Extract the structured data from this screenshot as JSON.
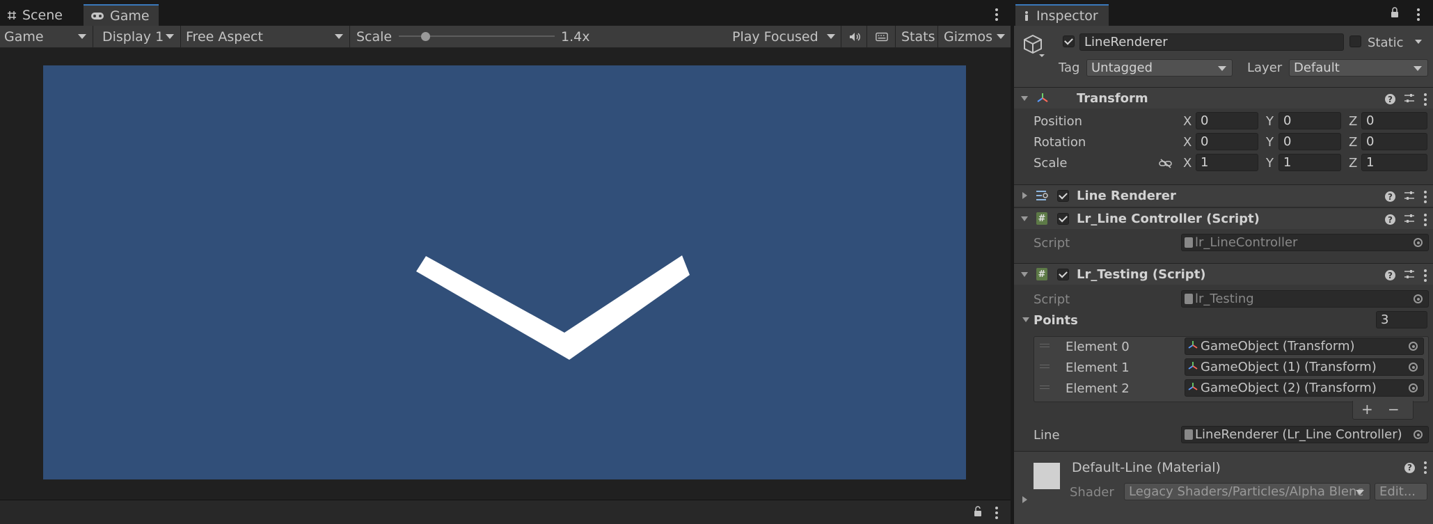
{
  "game_view": {
    "tabs": [
      {
        "label": "Scene",
        "icon": "hash-grid-icon"
      },
      {
        "label": "Game",
        "icon": "gamepad-icon"
      }
    ],
    "toolbar": {
      "mode": "Game",
      "display": "Display 1",
      "aspect": "Free Aspect",
      "scale_label": "Scale",
      "scale_value": "1.4x",
      "scale_slider_fraction": 0.17,
      "play_mode": "Play Focused",
      "stats": "Stats",
      "gizmos": "Gizmos"
    },
    "colors": {
      "canvas_bg": "#314f79",
      "line_color": "#ffffff",
      "tab_accent": "#3a79bb"
    }
  },
  "inspector": {
    "tab_label": "Inspector",
    "object": {
      "name": "LineRenderer",
      "active": true,
      "static_label": "Static",
      "static": false,
      "tag_label": "Tag",
      "tag": "Untagged",
      "layer_label": "Layer",
      "layer": "Default"
    },
    "transform": {
      "title": "Transform",
      "rows": [
        {
          "label": "Position",
          "x": "0",
          "y": "0",
          "z": "0"
        },
        {
          "label": "Rotation",
          "x": "0",
          "y": "0",
          "z": "0"
        },
        {
          "label": "Scale",
          "x": "1",
          "y": "1",
          "z": "1"
        }
      ],
      "axis_labels": [
        "X",
        "Y",
        "Z"
      ]
    },
    "line_renderer": {
      "title": "Line Renderer",
      "enabled": true
    },
    "controller_script": {
      "title": "Lr_Line Controller (Script)",
      "enabled": true,
      "script_label": "Script",
      "script_value": "lr_LineController"
    },
    "testing_script": {
      "title": "Lr_Testing (Script)",
      "enabled": true,
      "script_label": "Script",
      "script_value": "lr_Testing",
      "points_label": "Points",
      "points_count": "3",
      "elements": [
        {
          "label": "Element 0",
          "value": "GameObject (Transform)"
        },
        {
          "label": "Element 1",
          "value": "GameObject (1) (Transform)"
        },
        {
          "label": "Element 2",
          "value": "GameObject (2) (Transform)"
        }
      ],
      "add_label": "+",
      "remove_label": "−",
      "line_label": "Line",
      "line_value": "LineRenderer (Lr_Line Controller)"
    },
    "material": {
      "title": "Default-Line (Material)",
      "shader_label": "Shader",
      "shader_value": "Legacy Shaders/Particles/Alpha Blenc",
      "edit_label": "Edit..."
    }
  }
}
